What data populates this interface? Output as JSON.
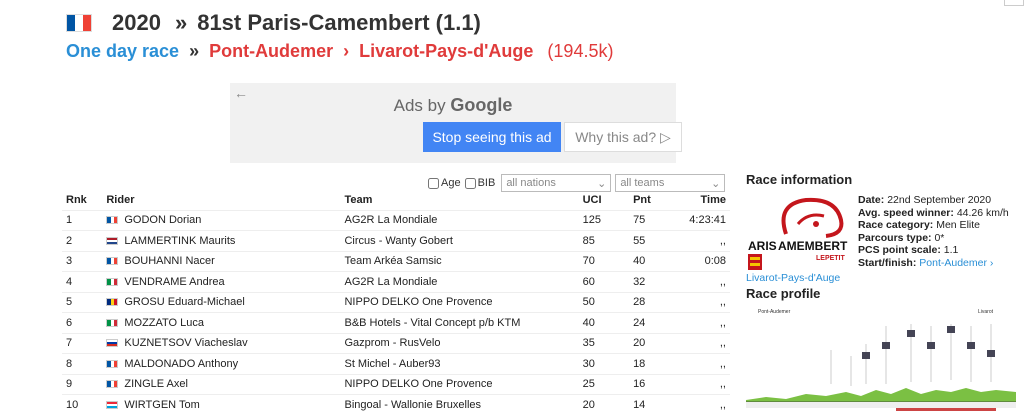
{
  "header": {
    "year": "2020",
    "race_name": "81st Paris-Camembert (1.1)",
    "title_sep": "»",
    "category": "One day race",
    "stage_sep": "»",
    "start": "Pont-Audemer",
    "route_sep": "›",
    "finish": "Livarot-Pays-d'Auge",
    "distance": "(194.5k)"
  },
  "ad": {
    "back_icon": "←",
    "ads_by": "Ads by",
    "google": "Google",
    "stop_label": "Stop seeing this ad",
    "why_label": "Why this ad? ▷"
  },
  "filters": {
    "age_label": "Age",
    "bib_label": "BIB",
    "nations_value": "all nations",
    "teams_value": "all teams"
  },
  "table": {
    "headers": {
      "rnk": "Rnk",
      "rider": "Rider",
      "team": "Team",
      "uci": "UCI",
      "pnt": "Pnt",
      "time": "Time"
    },
    "rows": [
      {
        "rnk": "1",
        "rider": "GODON Dorian",
        "team": "AG2R La Mondiale",
        "uci": "125",
        "pnt": "75",
        "time": "4:23:41",
        "flag": "fr"
      },
      {
        "rnk": "2",
        "rider": "LAMMERTINK Maurits",
        "team": "Circus - Wanty Gobert",
        "uci": "85",
        "pnt": "55",
        "time": ",,",
        "flag": "nl"
      },
      {
        "rnk": "3",
        "rider": "BOUHANNI Nacer",
        "team": "Team Arkéa Samsic",
        "uci": "70",
        "pnt": "40",
        "time": "0:08",
        "flag": "fr"
      },
      {
        "rnk": "4",
        "rider": "VENDRAME Andrea",
        "team": "AG2R La Mondiale",
        "uci": "60",
        "pnt": "32",
        "time": ",,",
        "flag": "it"
      },
      {
        "rnk": "5",
        "rider": "GROSU Eduard-Michael",
        "team": "NIPPO DELKO One Provence",
        "uci": "50",
        "pnt": "28",
        "time": ",,",
        "flag": "ro"
      },
      {
        "rnk": "6",
        "rider": "MOZZATO Luca",
        "team": "B&B Hotels - Vital Concept p/b KTM",
        "uci": "40",
        "pnt": "24",
        "time": ",,",
        "flag": "it"
      },
      {
        "rnk": "7",
        "rider": "KUZNETSOV Viacheslav",
        "team": "Gazprom - RusVelo",
        "uci": "35",
        "pnt": "20",
        "time": ",,",
        "flag": "ru"
      },
      {
        "rnk": "8",
        "rider": "MALDONADO Anthony",
        "team": "St Michel - Auber93",
        "uci": "30",
        "pnt": "18",
        "time": ",,",
        "flag": "fr"
      },
      {
        "rnk": "9",
        "rider": "ZINGLE Axel",
        "team": "NIPPO DELKO One Provence",
        "uci": "25",
        "pnt": "16",
        "time": ",,",
        "flag": "fr"
      },
      {
        "rnk": "10",
        "rider": "WIRTGEN Tom",
        "team": "Bingoal - Wallonie Bruxelles",
        "uci": "20",
        "pnt": "14",
        "time": ",,",
        "flag": "lu"
      }
    ]
  },
  "side": {
    "info_title": "Race information",
    "date_label": "Date:",
    "date_value": "22nd September 2020",
    "speed_label": "Avg. speed winner:",
    "speed_value": "44.26 km/h",
    "category_label": "Race category:",
    "category_value": "Men Elite",
    "parcours_label": "Parcours type:",
    "parcours_value": "0*",
    "pcs_label": "PCS point scale:",
    "pcs_value": "1.1",
    "startfinish_label": "Start/finish:",
    "startfinish_value": "Pont-Audemer ›",
    "finish_link": "Livarot-Pays-d'Auge",
    "profile_title": "Race profile",
    "logo_text_1": "ARIS",
    "logo_text_2": "AMEMBERT",
    "logo_text_3": "LEPETIT",
    "profile_start": "Pont-Audemer",
    "profile_finish": "Livarot"
  },
  "flags": {
    "fr": [
      "#0055a4",
      "#ffffff",
      "#ef4135"
    ],
    "nl": [
      "#ae1c28",
      "#ffffff",
      "#21468b"
    ],
    "it": [
      "#009246",
      "#ffffff",
      "#ce2b37"
    ],
    "ro": [
      "#002b7f",
      "#fcd116",
      "#ce1126"
    ],
    "ru": [
      "#ffffff",
      "#0039a6",
      "#d52b1e"
    ],
    "lu": [
      "#ed2939",
      "#ffffff",
      "#00a1de"
    ]
  },
  "colors": {
    "link": "#2a8fd6",
    "accent_red": "#e03b3b",
    "ad_button": "#4285f4"
  }
}
